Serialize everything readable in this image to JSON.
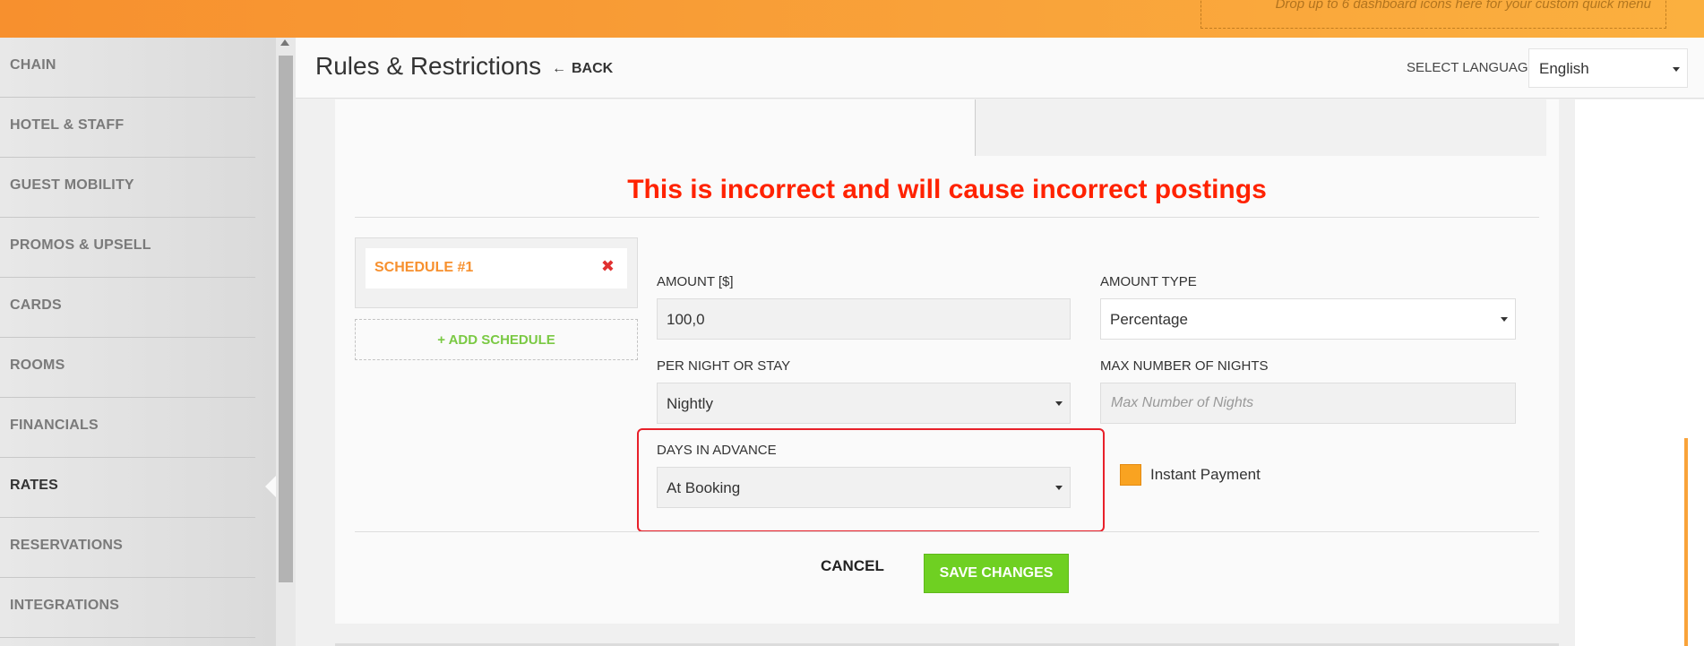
{
  "topbar": {
    "dropzone_hint": "Drop up to 6 dashboard icons here for your custom quick menu"
  },
  "sidebar": {
    "items": [
      {
        "label": "CHAIN"
      },
      {
        "label": "HOTEL & STAFF"
      },
      {
        "label": "GUEST MOBILITY"
      },
      {
        "label": "PROMOS & UPSELL"
      },
      {
        "label": "CARDS"
      },
      {
        "label": "ROOMS"
      },
      {
        "label": "FINANCIALS"
      },
      {
        "label": "RATES"
      },
      {
        "label": "RESERVATIONS"
      },
      {
        "label": "INTEGRATIONS"
      }
    ],
    "active": "RATES"
  },
  "header": {
    "title": "Rules & Restrictions",
    "back_label": "BACK",
    "language_label": "SELECT LANGUAGE",
    "language_value": "English"
  },
  "annotation": {
    "warning": "This is incorrect and will cause incorrect postings",
    "color": "#ff2200"
  },
  "schedules": {
    "items": [
      {
        "label": "SCHEDULE #1"
      }
    ],
    "add_label": "+ ADD SCHEDULE"
  },
  "form": {
    "amount_label": "AMOUNT [$]",
    "amount_value": "100,0",
    "amount_type_label": "AMOUNT TYPE",
    "amount_type_value": "Percentage",
    "per_night_label": "PER NIGHT OR STAY",
    "per_night_value": "Nightly",
    "max_nights_label": "MAX NUMBER OF NIGHTS",
    "max_nights_placeholder": "Max Number of Nights",
    "days_advance_label": "DAYS IN ADVANCE",
    "days_advance_value": "At Booking",
    "instant_payment_label": "Instant Payment"
  },
  "actions": {
    "cancel_label": "CANCEL",
    "save_label": "SAVE CHANGES"
  },
  "colors": {
    "brand_orange": "#f7902e",
    "save_green": "#6fd022",
    "add_green": "#7ac943",
    "delete_red": "#e03030"
  }
}
